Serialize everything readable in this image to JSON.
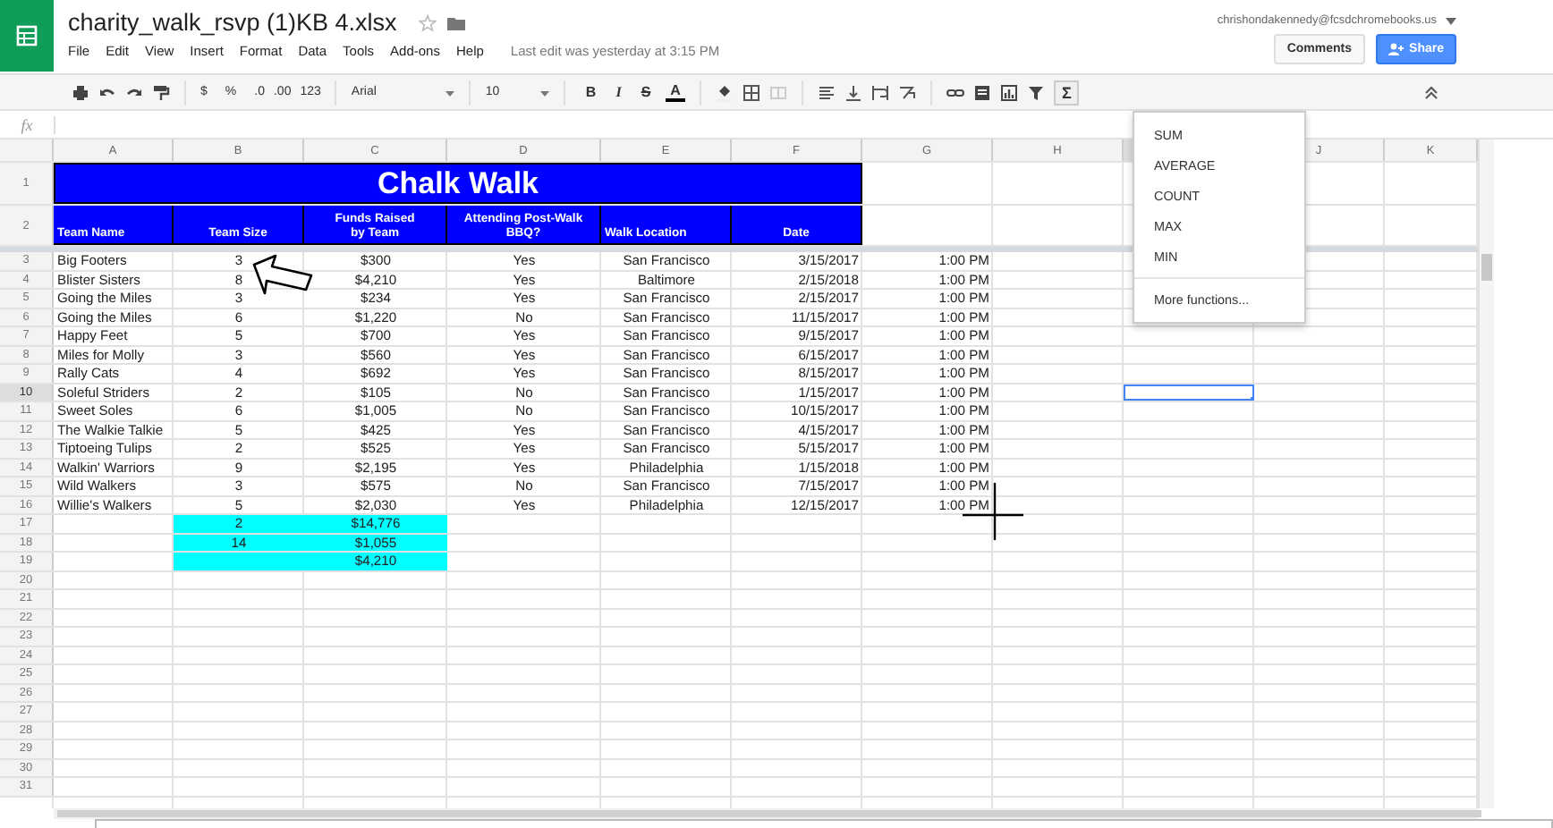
{
  "app": {
    "title": "charity_walk_rsvp (1)KB 4.xlsx",
    "menu": [
      "File",
      "Edit",
      "View",
      "Insert",
      "Format",
      "Data",
      "Tools",
      "Add-ons",
      "Help"
    ],
    "last_edit": "Last edit was yesterday at 3:15 PM",
    "account": "chrishondakennedy@fcsdchromebooks.us",
    "comments_button": "Comments",
    "share_button": "Share"
  },
  "toolbar": {
    "currency": "$",
    "percent": "%",
    "decrease_decimals": ".0",
    "increase_decimals": ".00",
    "number_format": "123",
    "font": "Arial",
    "font_size": "10",
    "format_buttons": [
      "B",
      "I",
      "S",
      "A"
    ],
    "functions_button": "Σ"
  },
  "formula_bar": {
    "label": "fx"
  },
  "sheet": {
    "columns": [
      {
        "label": "A",
        "selected": false
      },
      {
        "label": "B",
        "selected": false
      },
      {
        "label": "C",
        "selected": false
      },
      {
        "label": "D",
        "selected": false
      },
      {
        "label": "E",
        "selected": false
      },
      {
        "label": "F",
        "selected": false
      },
      {
        "label": "G",
        "selected": false
      },
      {
        "label": "H",
        "selected": false
      },
      {
        "selected": true
      },
      {
        "label": "J",
        "selected": false
      },
      {
        "label": "K",
        "selected": false
      }
    ],
    "row_labels": [
      {
        "label": "1",
        "selected": false
      },
      {
        "label": "2",
        "selected": false
      },
      {
        "label": "3",
        "selected": false
      },
      {
        "label": "4",
        "selected": false
      },
      {
        "label": "5",
        "selected": false
      },
      {
        "label": "6",
        "selected": false
      },
      {
        "label": "7",
        "selected": false
      },
      {
        "label": "8",
        "selected": false
      },
      {
        "label": "9",
        "selected": false
      },
      {
        "label": "10",
        "selected": true
      },
      {
        "label": "11",
        "selected": false
      },
      {
        "label": "12",
        "selected": false
      },
      {
        "label": "13",
        "selected": false
      },
      {
        "label": "14",
        "selected": false
      },
      {
        "label": "15",
        "selected": false
      },
      {
        "label": "16",
        "selected": false
      },
      {
        "label": "17",
        "selected": false
      },
      {
        "label": "18",
        "selected": false
      },
      {
        "label": "19",
        "selected": false
      },
      {
        "label": "20",
        "selected": false
      },
      {
        "label": "21",
        "selected": false
      },
      {
        "label": "22",
        "selected": false
      },
      {
        "label": "23",
        "selected": false
      },
      {
        "label": "24",
        "selected": false
      },
      {
        "label": "25",
        "selected": false
      },
      {
        "label": "26",
        "selected": false
      },
      {
        "label": "27",
        "selected": false
      },
      {
        "label": "28",
        "selected": false
      },
      {
        "label": "29",
        "selected": false
      },
      {
        "label": "30",
        "selected": false
      },
      {
        "label": "31",
        "selected": false
      }
    ],
    "title": "Chalk Walk",
    "headers": [
      {
        "lines": [
          "Team Name"
        ]
      },
      {
        "lines": [
          "Team Size"
        ]
      },
      {
        "lines": [
          "Funds Raised",
          "by Team"
        ]
      },
      {
        "lines": [
          "Attending Post-Walk",
          "BBQ?"
        ]
      },
      {
        "lines": [
          "Walk Location"
        ]
      },
      {
        "lines": [
          "Date"
        ]
      }
    ],
    "rows": [
      [
        "Big Footers",
        "3",
        "$300",
        "Yes",
        "San Francisco",
        "3/15/2017",
        "1:00 PM"
      ],
      [
        "Blister Sisters",
        "8",
        "$4,210",
        "Yes",
        "Baltimore",
        "2/15/2018",
        "1:00 PM"
      ],
      [
        "Going the Miles",
        "3",
        "$234",
        "Yes",
        "San Francisco",
        "2/15/2017",
        "1:00 PM"
      ],
      [
        "Going the Miles",
        "6",
        "$1,220",
        "No",
        "San Francisco",
        "11/15/2017",
        "1:00 PM"
      ],
      [
        "Happy Feet",
        "5",
        "$700",
        "Yes",
        "San Francisco",
        "9/15/2017",
        "1:00 PM"
      ],
      [
        "Miles for Molly",
        "3",
        "$560",
        "Yes",
        "San Francisco",
        "6/15/2017",
        "1:00 PM"
      ],
      [
        "Rally Cats",
        "4",
        "$692",
        "Yes",
        "San Francisco",
        "8/15/2017",
        "1:00 PM"
      ],
      [
        "Soleful Striders",
        "2",
        "$105",
        "No",
        "San Francisco",
        "1/15/2017",
        "1:00 PM"
      ],
      [
        "Sweet Soles",
        "6",
        "$1,005",
        "No",
        "San Francisco",
        "10/15/2017",
        "1:00 PM"
      ],
      [
        "The Walkie Talkie",
        "5",
        "$425",
        "Yes",
        "San Francisco",
        "4/15/2017",
        "1:00 PM"
      ],
      [
        "Tiptoeing Tulips",
        "2",
        "$525",
        "Yes",
        "San Francisco",
        "5/15/2017",
        "1:00 PM"
      ],
      [
        "Walkin' Warriors",
        "9",
        "$2,195",
        "Yes",
        "Philadelphia",
        "1/15/2018",
        "1:00 PM"
      ],
      [
        "Wild Walkers",
        "3",
        "$575",
        "No",
        "San Francisco",
        "7/15/2017",
        "1:00 PM"
      ],
      [
        "Willie's Walkers",
        "5",
        "$2,030",
        "Yes",
        "Philadelphia",
        "12/15/2017",
        "1:00 PM"
      ]
    ],
    "totals": [
      {
        "team_size": "2",
        "funds": "$14,776"
      },
      {
        "team_size": "14",
        "funds": "$1,055"
      },
      {
        "funds": "$4,210"
      }
    ]
  },
  "function_menu": {
    "items": [
      "SUM",
      "AVERAGE",
      "COUNT",
      "MAX",
      "MIN"
    ],
    "more": "More functions..."
  }
}
